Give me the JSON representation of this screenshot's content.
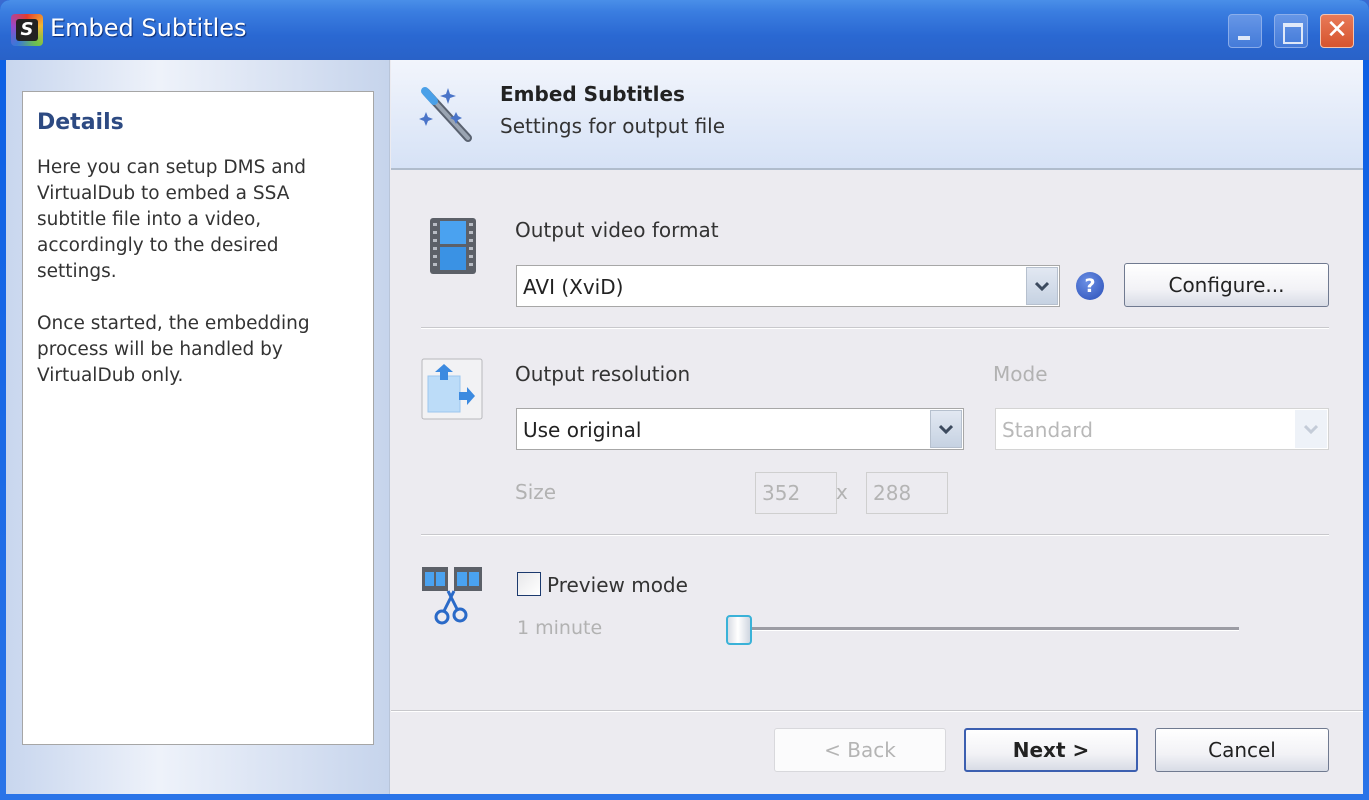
{
  "window": {
    "title": "Embed Subtitles",
    "app_icon_letter": "S",
    "controls": {
      "minimize": "minimize",
      "maximize": "maximize",
      "close": "✕"
    }
  },
  "details": {
    "title": "Details",
    "paragraph1": "Here you can setup DMS and VirtualDub to embed a SSA subtitle file into a video, accordingly to the desired settings.",
    "paragraph2": "Once started, the embedding process will be handled by VirtualDub only."
  },
  "header": {
    "title": "Embed Subtitles",
    "subtitle": "Settings for output file"
  },
  "output_format": {
    "label": "Output video format",
    "selected": "AVI (XviD)",
    "help": "?",
    "configure_label": "Configure..."
  },
  "output_resolution": {
    "label": "Output resolution",
    "selected": "Use original",
    "mode_label": "Mode",
    "mode_selected": "Standard",
    "size_label": "Size",
    "width": "352",
    "separator": "x",
    "height": "288"
  },
  "preview": {
    "checkbox_label": "Preview mode",
    "checked": false,
    "duration_label": "1 minute",
    "slider_value": 0
  },
  "footer": {
    "back_label": "< Back",
    "next_label": "Next >",
    "cancel_label": "Cancel"
  },
  "colors": {
    "titlebar": "#2a68d2",
    "details_title": "#2d4a82",
    "default_button_border": "#3c5fb0"
  }
}
